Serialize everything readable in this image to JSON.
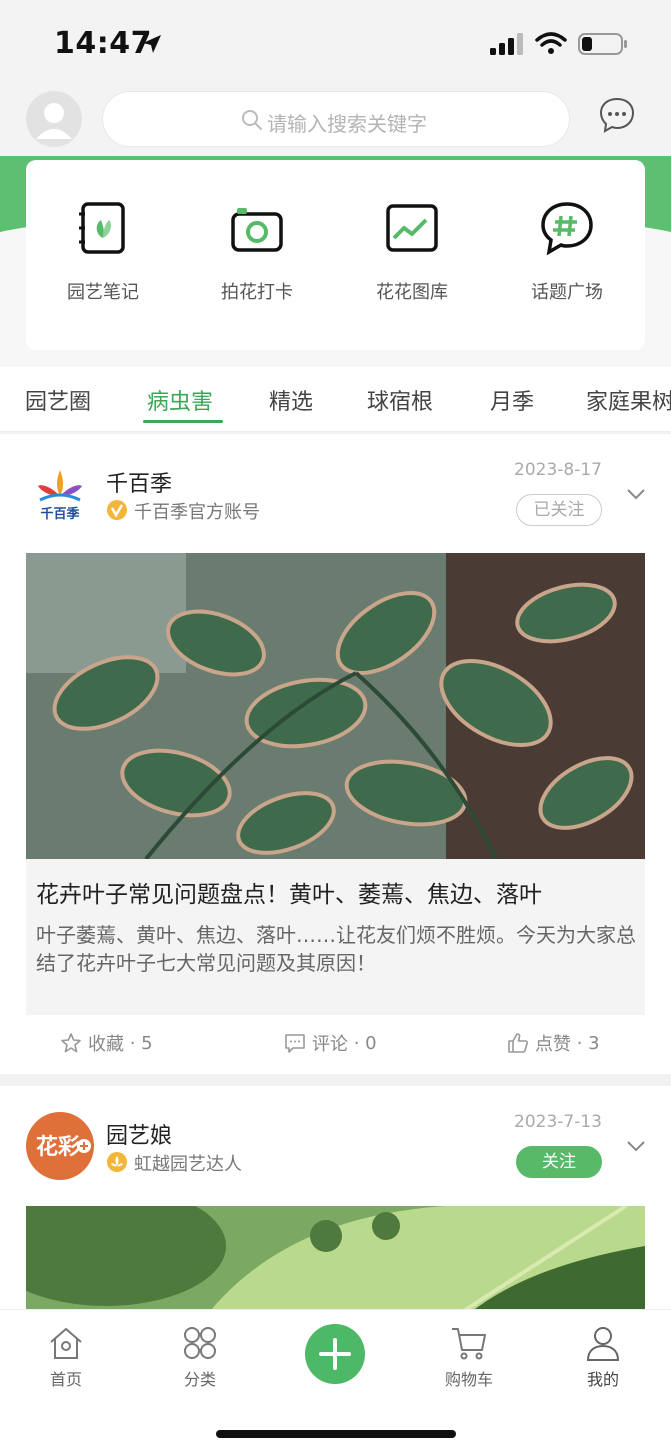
{
  "status_bar": {
    "time": "14:47"
  },
  "header": {
    "search_placeholder": "请输入搜索关键字"
  },
  "quick_menu": [
    {
      "label": "园艺笔记",
      "icon": "notebook-icon"
    },
    {
      "label": "拍花打卡",
      "icon": "camera-icon"
    },
    {
      "label": "花花图库",
      "icon": "gallery-icon"
    },
    {
      "label": "话题广场",
      "icon": "topic-chat-icon"
    }
  ],
  "tabs": [
    {
      "label": "园艺圈"
    },
    {
      "label": "病虫害"
    },
    {
      "label": "精选"
    },
    {
      "label": "球宿根"
    },
    {
      "label": "月季"
    },
    {
      "label": "家庭果树"
    }
  ],
  "active_tab": "病虫害",
  "posts": [
    {
      "author": "千百季",
      "author_sub": "千百季官方账号",
      "logo_text": "千百季",
      "date": "2023-8-17",
      "follow_label": "已关注",
      "title": "花卉叶子常见问题盘点！黄叶、萎蔫、焦边、落叶",
      "excerpt": "叶子萎蔫、黄叶、焦边、落叶……让花友们烦不胜烦。今天为大家总结了花卉叶子七大常见问题及其原因！",
      "actions": {
        "favorite_label": "收藏",
        "favorite_count": "5",
        "comment_label": "评论",
        "comment_count": "0",
        "like_label": "点赞",
        "like_count": "3"
      }
    },
    {
      "author": "园艺娘",
      "author_sub": "虹越园艺达人",
      "logo_text": "花彩",
      "date": "2023-7-13",
      "follow_label": "关注"
    }
  ],
  "bottom_nav": [
    {
      "label": "首页"
    },
    {
      "label": "分类"
    },
    {
      "label": "购物车"
    },
    {
      "label": "我的"
    }
  ],
  "colors": {
    "accent": "#3aa856",
    "band": "#5cbf72",
    "follow_bg": "#58b968"
  }
}
